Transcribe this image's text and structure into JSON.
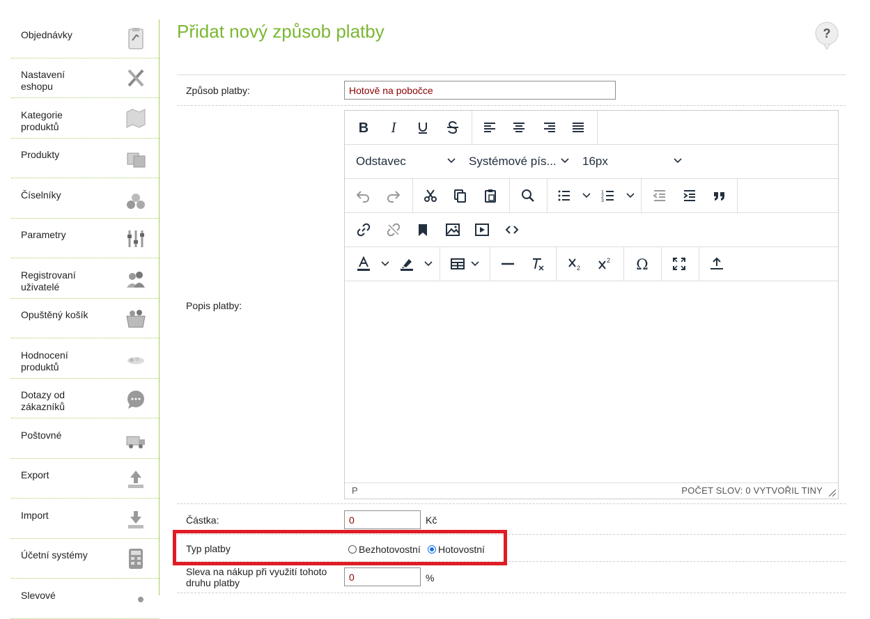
{
  "sidebar": {
    "items": [
      {
        "label": "Objednávky",
        "icon": "clipboard-icon"
      },
      {
        "label": "Nastavení eshopu",
        "icon": "tools-icon"
      },
      {
        "label": "Kategorie produktů",
        "icon": "map-icon"
      },
      {
        "label": "Produkty",
        "icon": "boxes-icon"
      },
      {
        "label": "Číselníky",
        "icon": "numbers-icon"
      },
      {
        "label": "Parametry",
        "icon": "sliders-icon"
      },
      {
        "label": "Registrovaní uživatelé",
        "icon": "users-icon"
      },
      {
        "label": "Opuštěný košík",
        "icon": "basket-icon"
      },
      {
        "label": "Hodnocení produktů",
        "icon": "rating-icon"
      },
      {
        "label": "Dotazy od zákazníků",
        "icon": "chat-icon"
      },
      {
        "label": "Poštovné",
        "icon": "truck-icon"
      },
      {
        "label": "Export",
        "icon": "upload-icon"
      },
      {
        "label": "Import",
        "icon": "download-icon"
      },
      {
        "label": "Účetní systémy",
        "icon": "calculator-icon"
      },
      {
        "label": "Slevové",
        "icon": "discount-icon"
      }
    ]
  },
  "page": {
    "title": "Přidat nový způsob platby",
    "help_label": "?"
  },
  "form": {
    "method_label": "Způsob platby:",
    "method_value": "Hotově na pobočce",
    "description_label": "Popis platby:",
    "amount_label": "Částka:",
    "amount_value": "0",
    "amount_unit": "Kč",
    "type_label": "Typ platby",
    "type_options": [
      "Bezhotovostní",
      "Hotovostní"
    ],
    "type_selected": "Hotovostní",
    "discount_label": "Sleva na nákup při využití tohoto druhu platby",
    "discount_value": "0",
    "discount_unit": "%"
  },
  "editor": {
    "format_select": "Odstavec",
    "font_select": "Systémové pís...",
    "size_select": "16px",
    "status_path": "P",
    "status_right": "POČET SLOV: 0  VYTVOŘIL TINY"
  },
  "colors": {
    "accent_green": "#7ab733",
    "highlight_red": "#e01b24",
    "radio_blue": "#1a73e8"
  }
}
